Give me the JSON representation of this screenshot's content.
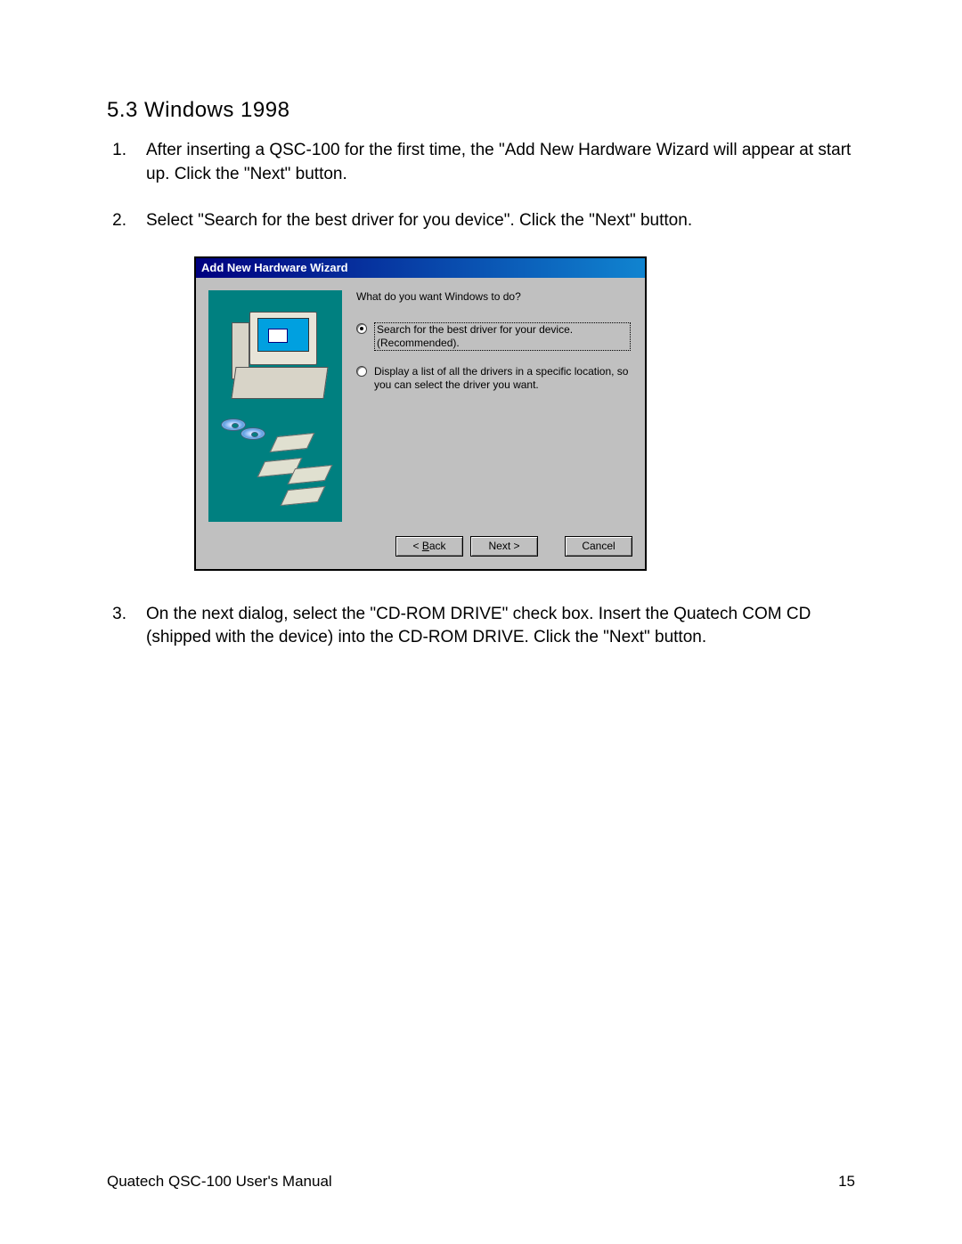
{
  "section_heading": "5.3  Windows 1998",
  "steps": [
    {
      "num": "1.",
      "text": "After inserting a QSC-100 for the first time, the \"Add New Hardware Wizard will appear at start up. Click the \"Next\" button."
    },
    {
      "num": "2.",
      "text": "Select \"Search for the best driver for you device\". Click the \"Next\" button."
    },
    {
      "num": "3.",
      "text": "On the next dialog, select the \"CD-ROM DRIVE\" check box. Insert the Quatech COM CD (shipped with the device) into the CD-ROM DRIVE. Click the \"Next\" button."
    }
  ],
  "dialog": {
    "title": "Add New Hardware Wizard",
    "prompt": "What do you want Windows to do?",
    "options": [
      {
        "label": "Search for the best driver for your device. (Recommended).",
        "selected": true
      },
      {
        "label": "Display a list of all the drivers in a specific location, so you can select the driver you want.",
        "selected": false
      }
    ],
    "buttons": {
      "back": "< Back",
      "next": "Next >",
      "cancel": "Cancel"
    }
  },
  "footer": {
    "left": "Quatech  QSC-100 User's Manual",
    "right": "15"
  }
}
